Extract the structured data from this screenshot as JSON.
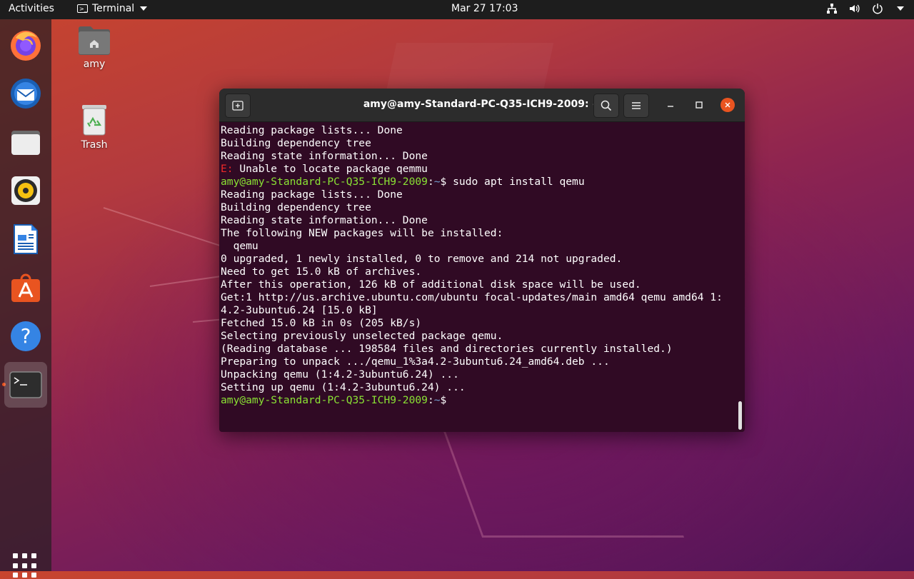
{
  "topbar": {
    "activities": "Activities",
    "app_name": "Terminal",
    "clock": "Mar 27  17:03"
  },
  "desktop": {
    "home_label": "amy",
    "trash_label": "Trash"
  },
  "dock": {
    "items": [
      "firefox",
      "thunderbird",
      "files",
      "rhythmbox",
      "libreoffice-writer",
      "ubuntu-software",
      "help",
      "terminal"
    ]
  },
  "terminal": {
    "title": "amy@amy-Standard-PC-Q35-ICH9-2009: ~",
    "prompt_user": "amy@amy-Standard-PC-Q35-ICH9-2009",
    "prompt_path": "~",
    "lines": [
      {
        "type": "out",
        "text": "Reading package lists... Done"
      },
      {
        "type": "out",
        "text": "Building dependency tree"
      },
      {
        "type": "out",
        "text": "Reading state information... Done"
      },
      {
        "type": "err",
        "prefix": "E:",
        "text": " Unable to locate package qemmu"
      },
      {
        "type": "cmd",
        "text": "$ sudo apt install qemu"
      },
      {
        "type": "out",
        "text": "Reading package lists... Done"
      },
      {
        "type": "out",
        "text": "Building dependency tree"
      },
      {
        "type": "out",
        "text": "Reading state information... Done"
      },
      {
        "type": "out",
        "text": "The following NEW packages will be installed:"
      },
      {
        "type": "out",
        "text": "  qemu"
      },
      {
        "type": "out",
        "text": "0 upgraded, 1 newly installed, 0 to remove and 214 not upgraded."
      },
      {
        "type": "out",
        "text": "Need to get 15.0 kB of archives."
      },
      {
        "type": "out",
        "text": "After this operation, 126 kB of additional disk space will be used."
      },
      {
        "type": "out",
        "text": "Get:1 http://us.archive.ubuntu.com/ubuntu focal-updates/main amd64 qemu amd64 1:"
      },
      {
        "type": "out",
        "text": "4.2-3ubuntu6.24 [15.0 kB]"
      },
      {
        "type": "out",
        "text": "Fetched 15.0 kB in 0s (205 kB/s)"
      },
      {
        "type": "out",
        "text": "Selecting previously unselected package qemu."
      },
      {
        "type": "out",
        "text": "(Reading database ... 198584 files and directories currently installed.)"
      },
      {
        "type": "out",
        "text": "Preparing to unpack .../qemu_1%3a4.2-3ubuntu6.24_amd64.deb ..."
      },
      {
        "type": "out",
        "text": "Unpacking qemu (1:4.2-3ubuntu6.24) ..."
      },
      {
        "type": "out",
        "text": "Setting up qemu (1:4.2-3ubuntu6.24) ..."
      },
      {
        "type": "cmd",
        "text": "$ "
      }
    ]
  },
  "colors": {
    "accent": "#e95420",
    "prompt_green": "#8ae234",
    "path_blue": "#729fcf",
    "error_red": "#ef2929",
    "terminal_bg": "#300a24"
  }
}
